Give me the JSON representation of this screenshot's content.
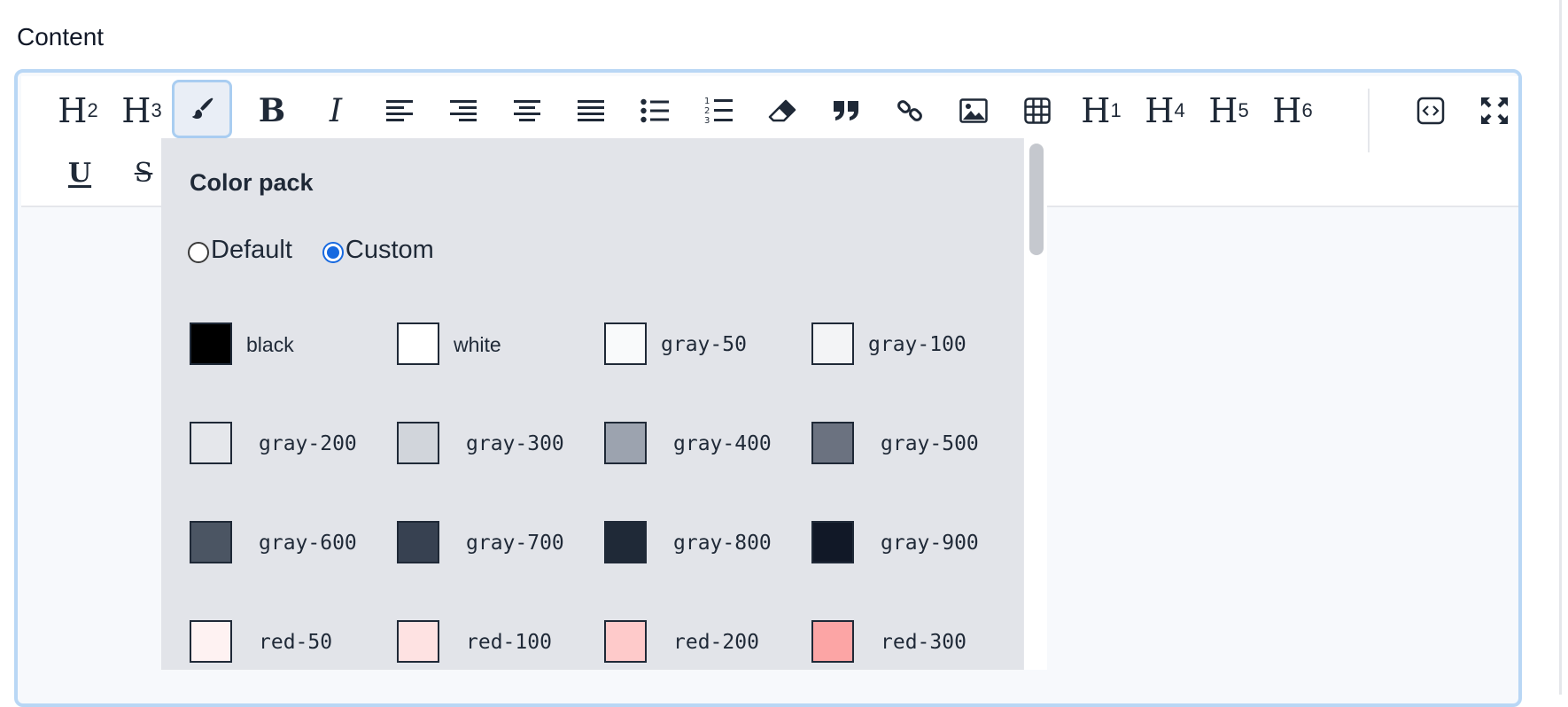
{
  "field": {
    "label": "Content"
  },
  "toolbar": {
    "row1": [
      {
        "name": "heading-2-button",
        "kind": "h",
        "main": "H",
        "sup": "2"
      },
      {
        "name": "heading-3-button",
        "kind": "h",
        "main": "H",
        "sup": "3"
      },
      {
        "name": "text-color-button",
        "kind": "icon",
        "icon": "paint-brush-icon",
        "active": true
      },
      {
        "name": "bold-button",
        "kind": "icon",
        "icon": "bold-icon"
      },
      {
        "name": "italic-button",
        "kind": "icon",
        "icon": "italic-icon"
      },
      {
        "name": "align-left-button",
        "kind": "icon",
        "icon": "align-left-icon"
      },
      {
        "name": "align-right-button",
        "kind": "icon",
        "icon": "align-right-icon"
      },
      {
        "name": "align-center-button",
        "kind": "icon",
        "icon": "align-center-icon"
      },
      {
        "name": "align-justify-button",
        "kind": "icon",
        "icon": "align-justify-icon"
      },
      {
        "name": "bullet-list-button",
        "kind": "icon",
        "icon": "bullet-list-icon"
      },
      {
        "name": "ordered-list-button",
        "kind": "icon",
        "icon": "ordered-list-icon"
      },
      {
        "name": "clear-format-button",
        "kind": "icon",
        "icon": "eraser-icon"
      },
      {
        "name": "blockquote-button",
        "kind": "icon",
        "icon": "quote-icon"
      },
      {
        "name": "link-button",
        "kind": "icon",
        "icon": "link-icon"
      },
      {
        "name": "image-button",
        "kind": "icon",
        "icon": "image-icon"
      },
      {
        "name": "table-button",
        "kind": "icon",
        "icon": "table-icon"
      },
      {
        "name": "heading-1-button",
        "kind": "h",
        "main": "H",
        "sup": "1"
      },
      {
        "name": "heading-4-button",
        "kind": "h",
        "main": "H",
        "sup": "4"
      },
      {
        "name": "heading-5-button",
        "kind": "h",
        "main": "H",
        "sup": "5"
      },
      {
        "name": "heading-6-button",
        "kind": "h",
        "main": "H",
        "sup": "6"
      },
      {
        "name": "source-code-button",
        "kind": "icon",
        "icon": "code-icon"
      },
      {
        "name": "fullscreen-button",
        "kind": "icon",
        "icon": "fullscreen-icon"
      }
    ],
    "row2": [
      {
        "name": "underline-button",
        "kind": "icon",
        "icon": "underline-icon",
        "text": "U"
      },
      {
        "name": "strikethrough-button",
        "kind": "icon",
        "icon": "strikethrough-icon",
        "text": "S"
      }
    ]
  },
  "color_popup": {
    "title": "Color pack",
    "options": [
      {
        "label": "Default",
        "checked": false
      },
      {
        "label": "Custom",
        "checked": true
      }
    ],
    "swatches": [
      {
        "label": "black",
        "color": "#000000"
      },
      {
        "label": "white",
        "color": "#ffffff"
      },
      {
        "label": "gray-50",
        "color": "#f9fafb"
      },
      {
        "label": "gray-100",
        "color": "#f3f4f6"
      },
      {
        "label": "gray-200",
        "color": "#e5e7eb"
      },
      {
        "label": "gray-300",
        "color": "#d1d5db"
      },
      {
        "label": "gray-400",
        "color": "#9ca3af"
      },
      {
        "label": "gray-500",
        "color": "#6b7280"
      },
      {
        "label": "gray-600",
        "color": "#4b5563"
      },
      {
        "label": "gray-700",
        "color": "#374151"
      },
      {
        "label": "gray-800",
        "color": "#1f2937"
      },
      {
        "label": "gray-900",
        "color": "#111827"
      },
      {
        "label": "red-50",
        "color": "#fef2f2"
      },
      {
        "label": "red-100",
        "color": "#fee2e2"
      },
      {
        "label": "red-200",
        "color": "#fecaca"
      },
      {
        "label": "red-300",
        "color": "#fca5a5"
      }
    ]
  }
}
